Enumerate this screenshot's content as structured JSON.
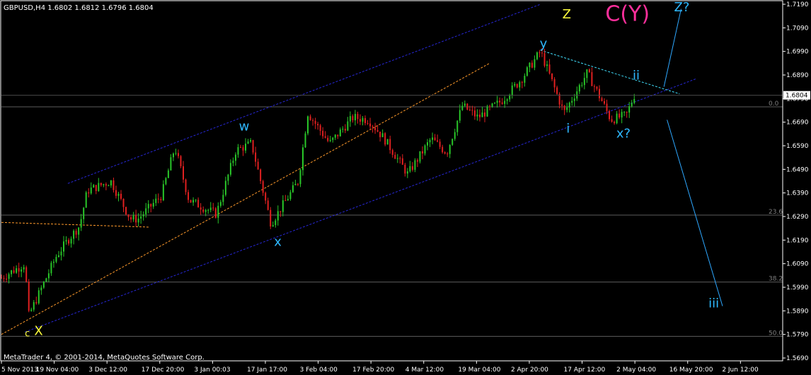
{
  "chart_data": {
    "type": "candlestick",
    "symbol_info": "GBPUSD,H4  1.6802 1.6812 1.6796 1.6804",
    "copyright": "MetaTrader 4, © 2001-2014, MetaQuotes Software Corp.",
    "ylim": [
      1.569,
      1.719
    ],
    "y_ticks": [
      "1.7190",
      "1.7090",
      "1.6990",
      "1.6890",
      "1.6790",
      "1.6690",
      "1.6590",
      "1.6490",
      "1.6390",
      "1.6290",
      "1.6190",
      "1.6090",
      "1.5990",
      "1.5890",
      "1.5790",
      "1.5690"
    ],
    "x_ticks": [
      "5 Nov 2013",
      "19 Nov 04:00",
      "3 Dec 12:00",
      "17 Dec 20:00",
      "3 Jan 00:03",
      "17 Jan 17:00",
      "3 Feb 04:00",
      "17 Feb 20:00",
      "4 Mar 12:00",
      "19 Mar 04:00",
      "2 Apr 20:00",
      "17 Apr 12:00",
      "2 May 04:00",
      "16 May 20:00",
      "2 Jun 12:00"
    ],
    "current_price": "1.6804",
    "fib_levels": [
      {
        "label": "0.0",
        "price": 1.6755
      },
      {
        "label": "23.6",
        "price": 1.6296
      },
      {
        "label": "38.2",
        "price": 1.6012
      },
      {
        "label": "50.0",
        "price": 1.5782
      }
    ],
    "wave_labels": [
      {
        "text": "C(Y)",
        "price": 1.712,
        "bar": 0.773,
        "color": "#ff2f9c"
      },
      {
        "text": "Z",
        "price": 1.713,
        "bar": 0.718,
        "color": "#ffff3c"
      },
      {
        "text": "Z?",
        "price": 1.716,
        "bar": 0.861,
        "color": "#2eb8ff"
      },
      {
        "text": "y",
        "price": 1.7005,
        "bar": 0.689,
        "color": "#2eb8ff"
      },
      {
        "text": "ii",
        "price": 1.687,
        "bar": 0.808,
        "color": "#2eb8ff"
      },
      {
        "text": "w",
        "price": 1.6655,
        "bar": 0.304,
        "color": "#2eb8ff"
      },
      {
        "text": "i",
        "price": 1.6645,
        "bar": 0.723,
        "color": "#2eb8ff"
      },
      {
        "text": "x?",
        "price": 1.6625,
        "bar": 0.787,
        "color": "#2eb8ff"
      },
      {
        "text": "x",
        "price": 1.6165,
        "bar": 0.349,
        "color": "#2eb8ff"
      },
      {
        "text": "iii",
        "price": 1.5905,
        "bar": 0.905,
        "color": "#2eb8ff"
      },
      {
        "text": "X",
        "price": 1.5788,
        "bar": 0.042,
        "color": "#ffff3c"
      },
      {
        "text": "c",
        "price": 1.5781,
        "bar": 0.03,
        "color": "#ffff3c"
      }
    ],
    "swing_points": [
      {
        "bar": 0.0,
        "price": 1.603
      },
      {
        "bar": 0.03,
        "price": 1.609
      },
      {
        "bar": 0.035,
        "price": 1.587
      },
      {
        "bar": 0.07,
        "price": 1.612
      },
      {
        "bar": 0.085,
        "price": 1.619
      },
      {
        "bar": 0.1,
        "price": 1.625
      },
      {
        "bar": 0.11,
        "price": 1.64
      },
      {
        "bar": 0.14,
        "price": 1.644
      },
      {
        "bar": 0.165,
        "price": 1.628
      },
      {
        "bar": 0.175,
        "price": 1.628
      },
      {
        "bar": 0.205,
        "price": 1.638
      },
      {
        "bar": 0.222,
        "price": 1.6585
      },
      {
        "bar": 0.24,
        "price": 1.636
      },
      {
        "bar": 0.275,
        "price": 1.63
      },
      {
        "bar": 0.3,
        "price": 1.657
      },
      {
        "bar": 0.32,
        "price": 1.66
      },
      {
        "bar": 0.345,
        "price": 1.626
      },
      {
        "bar": 0.38,
        "price": 1.644
      },
      {
        "bar": 0.392,
        "price": 1.673
      },
      {
        "bar": 0.42,
        "price": 1.66
      },
      {
        "bar": 0.45,
        "price": 1.671
      },
      {
        "bar": 0.47,
        "price": 1.67
      },
      {
        "bar": 0.49,
        "price": 1.662
      },
      {
        "bar": 0.52,
        "price": 1.647
      },
      {
        "bar": 0.55,
        "price": 1.662
      },
      {
        "bar": 0.57,
        "price": 1.656
      },
      {
        "bar": 0.59,
        "price": 1.676
      },
      {
        "bar": 0.61,
        "price": 1.671
      },
      {
        "bar": 0.64,
        "price": 1.678
      },
      {
        "bar": 0.665,
        "price": 1.687
      },
      {
        "bar": 0.69,
        "price": 1.699
      },
      {
        "bar": 0.705,
        "price": 1.686
      },
      {
        "bar": 0.72,
        "price": 1.673
      },
      {
        "bar": 0.75,
        "price": 1.69
      },
      {
        "bar": 0.77,
        "price": 1.677
      },
      {
        "bar": 0.78,
        "price": 1.67
      },
      {
        "bar": 0.8,
        "price": 1.672
      },
      {
        "bar": 0.81,
        "price": 1.6804
      }
    ]
  }
}
